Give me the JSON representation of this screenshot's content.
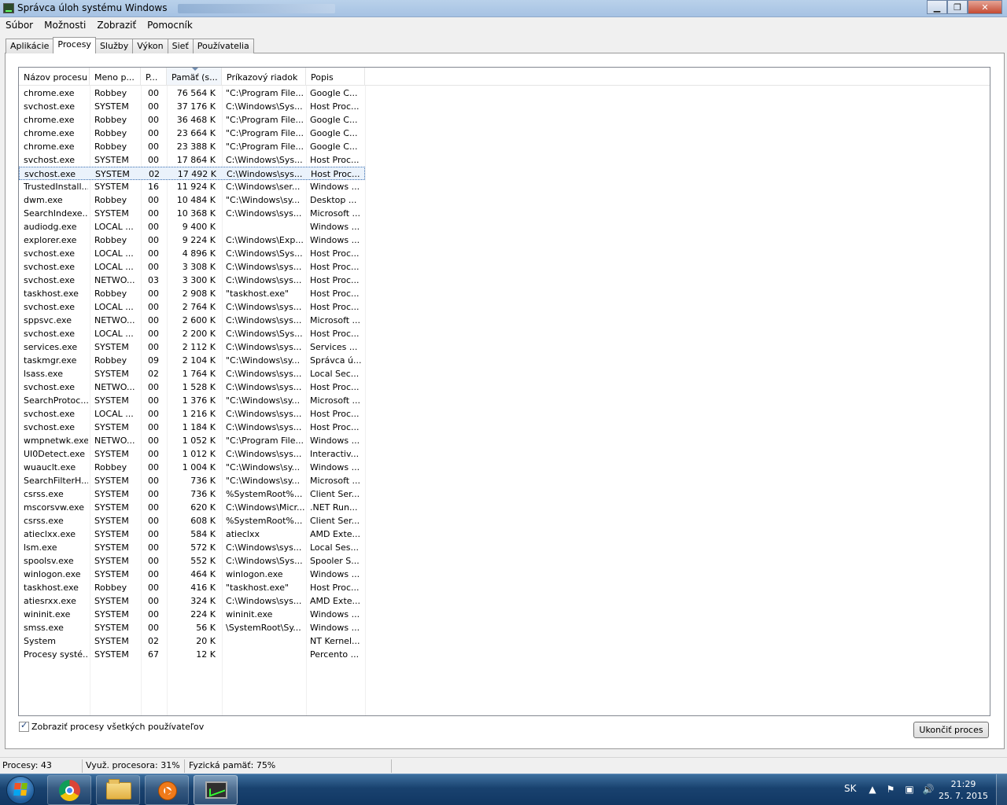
{
  "window": {
    "title": "Správca úloh systému Windows",
    "minimize_glyph": "▁",
    "maximize_glyph": "❐",
    "close_glyph": "✕"
  },
  "menu": [
    "Súbor",
    "Možnosti",
    "Zobraziť",
    "Pomocník"
  ],
  "tabs": [
    "Aplikácie",
    "Procesy",
    "Služby",
    "Výkon",
    "Sieť",
    "Používatelia"
  ],
  "active_tab": "Procesy",
  "columns": [
    "Názov procesu",
    "Meno p...",
    "P...",
    "Pamäť (s...",
    "Príkazový riadok",
    "Popis"
  ],
  "processes": [
    [
      "chrome.exe",
      "Robbey",
      "00",
      "76 564 K",
      "\"C:\\Program File...",
      "Google C..."
    ],
    [
      "svchost.exe",
      "SYSTEM",
      "00",
      "37 176 K",
      "C:\\Windows\\Sys...",
      "Host Proc..."
    ],
    [
      "chrome.exe",
      "Robbey",
      "00",
      "36 468 K",
      "\"C:\\Program File...",
      "Google C..."
    ],
    [
      "chrome.exe",
      "Robbey",
      "00",
      "23 664 K",
      "\"C:\\Program File...",
      "Google C..."
    ],
    [
      "chrome.exe",
      "Robbey",
      "00",
      "23 388 K",
      "\"C:\\Program File...",
      "Google C..."
    ],
    [
      "svchost.exe",
      "SYSTEM",
      "00",
      "17 864 K",
      "C:\\Windows\\Sys...",
      "Host Proc..."
    ],
    [
      "svchost.exe",
      "SYSTEM",
      "02",
      "17 492 K",
      "C:\\Windows\\sys...",
      "Host Proc..."
    ],
    [
      "TrustedInstall...",
      "SYSTEM",
      "16",
      "11 924 K",
      "C:\\Windows\\ser...",
      "Windows ..."
    ],
    [
      "dwm.exe",
      "Robbey",
      "00",
      "10 484 K",
      "\"C:\\Windows\\sy...",
      "Desktop ..."
    ],
    [
      "SearchIndexe...",
      "SYSTEM",
      "00",
      "10 368 K",
      "C:\\Windows\\sys...",
      "Microsoft ..."
    ],
    [
      "audiodg.exe",
      "LOCAL ...",
      "00",
      "9 400 K",
      "",
      "Windows ..."
    ],
    [
      "explorer.exe",
      "Robbey",
      "00",
      "9 224 K",
      "C:\\Windows\\Exp...",
      "Windows ..."
    ],
    [
      "svchost.exe",
      "LOCAL ...",
      "00",
      "4 896 K",
      "C:\\Windows\\Sys...",
      "Host Proc..."
    ],
    [
      "svchost.exe",
      "LOCAL ...",
      "00",
      "3 308 K",
      "C:\\Windows\\sys...",
      "Host Proc..."
    ],
    [
      "svchost.exe",
      "NETWO...",
      "03",
      "3 300 K",
      "C:\\Windows\\sys...",
      "Host Proc..."
    ],
    [
      "taskhost.exe",
      "Robbey",
      "00",
      "2 908 K",
      "\"taskhost.exe\"",
      "Host Proc..."
    ],
    [
      "svchost.exe",
      "LOCAL ...",
      "00",
      "2 764 K",
      "C:\\Windows\\sys...",
      "Host Proc..."
    ],
    [
      "sppsvc.exe",
      "NETWO...",
      "00",
      "2 600 K",
      "C:\\Windows\\sys...",
      "Microsoft ..."
    ],
    [
      "svchost.exe",
      "LOCAL ...",
      "00",
      "2 200 K",
      "C:\\Windows\\Sys...",
      "Host Proc..."
    ],
    [
      "services.exe",
      "SYSTEM",
      "00",
      "2 112 K",
      "C:\\Windows\\sys...",
      "Services ..."
    ],
    [
      "taskmgr.exe",
      "Robbey",
      "09",
      "2 104 K",
      "\"C:\\Windows\\sy...",
      "Správca ú..."
    ],
    [
      "lsass.exe",
      "SYSTEM",
      "02",
      "1 764 K",
      "C:\\Windows\\sys...",
      "Local Sec..."
    ],
    [
      "svchost.exe",
      "NETWO...",
      "00",
      "1 528 K",
      "C:\\Windows\\sys...",
      "Host Proc..."
    ],
    [
      "SearchProtoc...",
      "SYSTEM",
      "00",
      "1 376 K",
      "\"C:\\Windows\\sy...",
      "Microsoft ..."
    ],
    [
      "svchost.exe",
      "LOCAL ...",
      "00",
      "1 216 K",
      "C:\\Windows\\sys...",
      "Host Proc..."
    ],
    [
      "svchost.exe",
      "SYSTEM",
      "00",
      "1 184 K",
      "C:\\Windows\\sys...",
      "Host Proc..."
    ],
    [
      "wmpnetwk.exe",
      "NETWO...",
      "00",
      "1 052 K",
      "\"C:\\Program File...",
      "Windows ..."
    ],
    [
      "UI0Detect.exe",
      "SYSTEM",
      "00",
      "1 012 K",
      "C:\\Windows\\sys...",
      "Interactiv..."
    ],
    [
      "wuauclt.exe",
      "Robbey",
      "00",
      "1 004 K",
      "\"C:\\Windows\\sy...",
      "Windows ..."
    ],
    [
      "SearchFilterH...",
      "SYSTEM",
      "00",
      "736 K",
      "\"C:\\Windows\\sy...",
      "Microsoft ..."
    ],
    [
      "csrss.exe",
      "SYSTEM",
      "00",
      "736 K",
      "%SystemRoot%...",
      "Client Ser..."
    ],
    [
      "mscorsvw.exe",
      "SYSTEM",
      "00",
      "620 K",
      "C:\\Windows\\Micr...",
      ".NET Run..."
    ],
    [
      "csrss.exe",
      "SYSTEM",
      "00",
      "608 K",
      "%SystemRoot%...",
      "Client Ser..."
    ],
    [
      "atieclxx.exe",
      "SYSTEM",
      "00",
      "584 K",
      "atieclxx",
      "AMD Exte..."
    ],
    [
      "lsm.exe",
      "SYSTEM",
      "00",
      "572 K",
      "C:\\Windows\\sys...",
      "Local Ses..."
    ],
    [
      "spoolsv.exe",
      "SYSTEM",
      "00",
      "552 K",
      "C:\\Windows\\Sys...",
      "Spooler S..."
    ],
    [
      "winlogon.exe",
      "SYSTEM",
      "00",
      "464 K",
      "winlogon.exe",
      "Windows ..."
    ],
    [
      "taskhost.exe",
      "Robbey",
      "00",
      "416 K",
      "\"taskhost.exe\"",
      "Host Proc..."
    ],
    [
      "atiesrxx.exe",
      "SYSTEM",
      "00",
      "324 K",
      "C:\\Windows\\sys...",
      "AMD Exte..."
    ],
    [
      "wininit.exe",
      "SYSTEM",
      "00",
      "224 K",
      "wininit.exe",
      "Windows ..."
    ],
    [
      "smss.exe",
      "SYSTEM",
      "00",
      "56 K",
      "\\SystemRoot\\Sy...",
      "Windows ..."
    ],
    [
      "System",
      "SYSTEM",
      "02",
      "20 K",
      "",
      "NT Kernel..."
    ],
    [
      "Procesy systé...",
      "SYSTEM",
      "67",
      "12 K",
      "",
      "Percento ..."
    ]
  ],
  "selected_row": 6,
  "show_all_users_label": "Zobraziť procesy všetkých používateľov",
  "show_all_users_checked": true,
  "end_process_label": "Ukončiť proces",
  "status": {
    "processes": "Procesy: 43",
    "cpu": "Využ. procesora: 31%",
    "memory": "Fyzická pamäť: 75%"
  },
  "taskbar": {
    "apps": [
      "chrome-icon",
      "folder-icon",
      "media-player-icon",
      "task-manager-icon"
    ],
    "language": "SK",
    "time": "21:29",
    "date": "25. 7. 2015"
  }
}
